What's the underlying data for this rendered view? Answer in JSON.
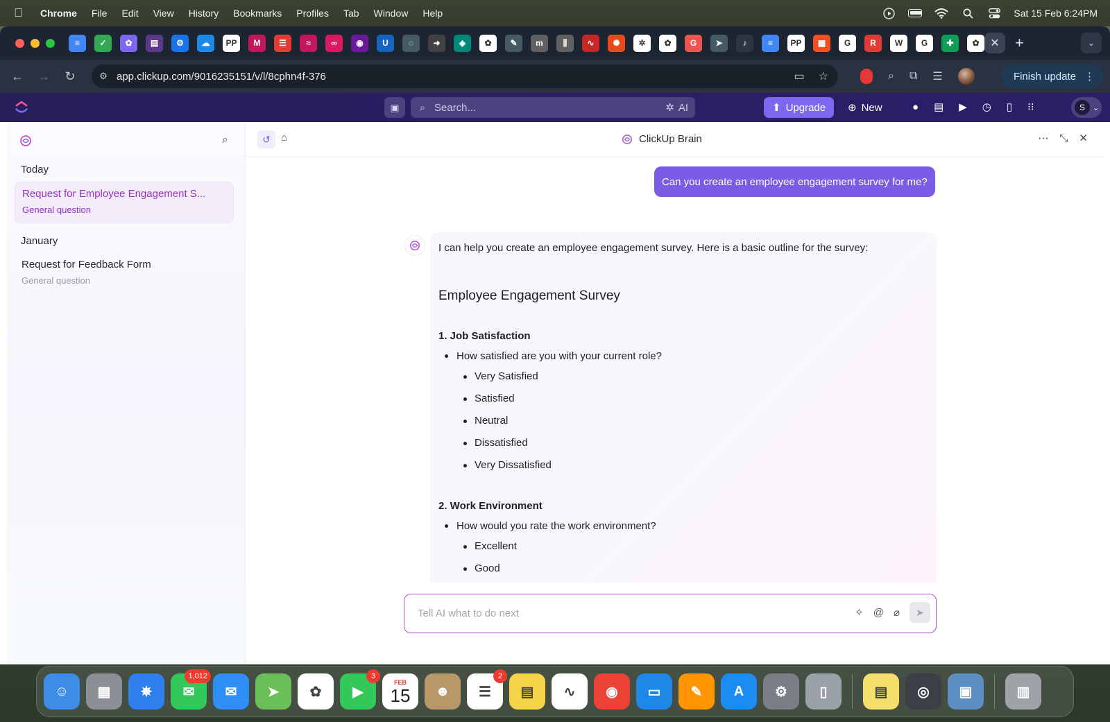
{
  "menubar": {
    "app_name": "Chrome",
    "items": [
      "File",
      "Edit",
      "View",
      "History",
      "Bookmarks",
      "Profiles",
      "Tab",
      "Window",
      "Help"
    ],
    "clock": "Sat 15 Feb  6:24PM"
  },
  "browser": {
    "url": "app.clickup.com/9016235151/v/l/8cphn4f-376",
    "finish_update": "Finish update",
    "tab_favicons": [
      {
        "icon": "docs-icon",
        "color": "#4285f4",
        "glyph": "≡"
      },
      {
        "icon": "check-icon",
        "color": "#34a853",
        "glyph": "✓"
      },
      {
        "icon": "clickup-icon",
        "color": "#7b68ee",
        "glyph": "✿"
      },
      {
        "icon": "app-icon",
        "color": "#5b3a8c",
        "glyph": "▤"
      },
      {
        "icon": "gear-icon",
        "color": "#1a73e8",
        "glyph": "⚙"
      },
      {
        "icon": "cloud-icon",
        "color": "#1e88e5",
        "glyph": "☁"
      },
      {
        "icon": "pp-icon",
        "color": "#ffffff",
        "glyph": "PP"
      },
      {
        "icon": "m-icon",
        "color": "#c2185b",
        "glyph": "M"
      },
      {
        "icon": "stack-icon",
        "color": "#e53935",
        "glyph": "☰"
      },
      {
        "icon": "rss-icon",
        "color": "#c2185b",
        "glyph": "≈"
      },
      {
        "icon": "link-icon",
        "color": "#d81b60",
        "glyph": "∞"
      },
      {
        "icon": "circle-icon",
        "color": "#6a1b9a",
        "glyph": "◉"
      },
      {
        "icon": "u-icon",
        "color": "#1565c0",
        "glyph": "U"
      },
      {
        "icon": "ring-icon",
        "color": "#455a64",
        "glyph": "◌"
      },
      {
        "icon": "arrow-icon",
        "color": "#424242",
        "glyph": "➜"
      },
      {
        "icon": "shield-icon",
        "color": "#00897b",
        "glyph": "◈"
      },
      {
        "icon": "clickup-icon",
        "color": "#ffffff",
        "glyph": "✿"
      },
      {
        "icon": "pencil-icon",
        "color": "#455a64",
        "glyph": "✎"
      },
      {
        "icon": "m-circle-icon",
        "color": "#616161",
        "glyph": "m"
      },
      {
        "icon": "bars-icon",
        "color": "#616161",
        "glyph": "⫼"
      },
      {
        "icon": "wave-icon",
        "color": "#c62828",
        "glyph": "∿"
      },
      {
        "icon": "spark-icon",
        "color": "#e64a19",
        "glyph": "✺"
      },
      {
        "icon": "openai-icon",
        "color": "#ffffff",
        "glyph": "✲"
      },
      {
        "icon": "clickup-icon",
        "color": "#ffffff",
        "glyph": "✿"
      },
      {
        "icon": "g-icon",
        "color": "#ef5350",
        "glyph": "G"
      },
      {
        "icon": "send-icon",
        "color": "#455a64",
        "glyph": "➤"
      },
      {
        "icon": "speaker-icon",
        "color": "#2d3442",
        "glyph": "♪"
      },
      {
        "icon": "docs-icon",
        "color": "#4285f4",
        "glyph": "≡"
      },
      {
        "icon": "pp-icon",
        "color": "#ffffff",
        "glyph": "PP"
      },
      {
        "icon": "microsoft-icon",
        "color": "#f25022",
        "glyph": "▦"
      },
      {
        "icon": "google-icon",
        "color": "#ffffff",
        "glyph": "G"
      },
      {
        "icon": "r-icon",
        "color": "#e53935",
        "glyph": "R"
      },
      {
        "icon": "wikipedia-icon",
        "color": "#ffffff",
        "glyph": "W"
      },
      {
        "icon": "google-icon",
        "color": "#ffffff",
        "glyph": "G"
      },
      {
        "icon": "sheets-icon",
        "color": "#0f9d58",
        "glyph": "✚"
      },
      {
        "icon": "clickup-icon",
        "color": "#ffffff",
        "glyph": "✿"
      }
    ]
  },
  "clickup_bar": {
    "search_placeholder": "Search...",
    "ai_label": "AI",
    "upgrade_label": "Upgrade",
    "new_label": "New",
    "avatar_initial": "S"
  },
  "sidebar": {
    "sections": [
      {
        "label": "Today",
        "items": [
          {
            "title": "Request for Employee Engagement S...",
            "subtitle": "General question",
            "active": true
          }
        ]
      },
      {
        "label": "January",
        "items": [
          {
            "title": "Request for Feedback Form",
            "subtitle": "General question",
            "active": false
          }
        ]
      }
    ]
  },
  "brain": {
    "title": "ClickUp Brain",
    "user_message": "Can you create an employee engagement survey for me?",
    "ai_intro": "I can help you create an employee engagement survey. Here is a basic outline for the survey:",
    "survey_title": "Employee Engagement Survey",
    "sections": [
      {
        "heading": "1. Job Satisfaction",
        "question": "How satisfied are you with your current role?",
        "options": [
          "Very Satisfied",
          "Satisfied",
          "Neutral",
          "Dissatisfied",
          "Very Dissatisfied"
        ]
      },
      {
        "heading": "2. Work Environment",
        "question": "How would you rate the work environment?",
        "options": [
          "Excellent",
          "Good"
        ]
      }
    ],
    "input_placeholder": "Tell AI what to do next"
  },
  "dock": {
    "apps": [
      {
        "name": "finder-icon",
        "color": "#3d8ce6",
        "glyph": "☺"
      },
      {
        "name": "launchpad-icon",
        "color": "#8b8f96",
        "glyph": "▦"
      },
      {
        "name": "safari-icon",
        "color": "#2f80ed",
        "glyph": "✵"
      },
      {
        "name": "messages-icon",
        "color": "#34c759",
        "glyph": "✉",
        "badge": "1,012"
      },
      {
        "name": "mail-icon",
        "color": "#2f8ff5",
        "glyph": "✉"
      },
      {
        "name": "maps-icon",
        "color": "#6bbf59",
        "glyph": "➤"
      },
      {
        "name": "photos-icon",
        "color": "#ffffff",
        "glyph": "✿"
      },
      {
        "name": "facetime-icon",
        "color": "#34c759",
        "glyph": "▶",
        "badge": "3"
      },
      {
        "name": "calendar-icon",
        "color": "#ffffff",
        "glyph": "",
        "month": "FEB",
        "day": "15"
      },
      {
        "name": "contacts-icon",
        "color": "#b89868",
        "glyph": "☻"
      },
      {
        "name": "reminders-icon",
        "color": "#ffffff",
        "glyph": "☰",
        "badge": "2"
      },
      {
        "name": "notes-icon",
        "color": "#f5d34a",
        "glyph": "▤"
      },
      {
        "name": "freeform-icon",
        "color": "#ffffff",
        "glyph": "∿"
      },
      {
        "name": "chrome-icon",
        "color": "#ea4335",
        "glyph": "◉"
      },
      {
        "name": "keynote-icon",
        "color": "#1e88e5",
        "glyph": "▭"
      },
      {
        "name": "pages-icon",
        "color": "#ff9500",
        "glyph": "✎"
      },
      {
        "name": "app-store-icon",
        "color": "#1c8cf5",
        "glyph": "A"
      },
      {
        "name": "system-settings-icon",
        "color": "#7a7f87",
        "glyph": "⚙"
      },
      {
        "name": "iphone-mirroring-icon",
        "color": "#9aa0a8",
        "glyph": "▯"
      },
      {
        "name": "stickies-icon",
        "color": "#f5df6a",
        "glyph": "▤"
      },
      {
        "name": "quicktime-icon",
        "color": "#3a3f48",
        "glyph": "◎"
      },
      {
        "name": "preview-icon",
        "color": "#5d8ec2",
        "glyph": "▣"
      },
      {
        "name": "trash-icon",
        "color": "#9ea3a8",
        "glyph": "▥"
      }
    ]
  }
}
